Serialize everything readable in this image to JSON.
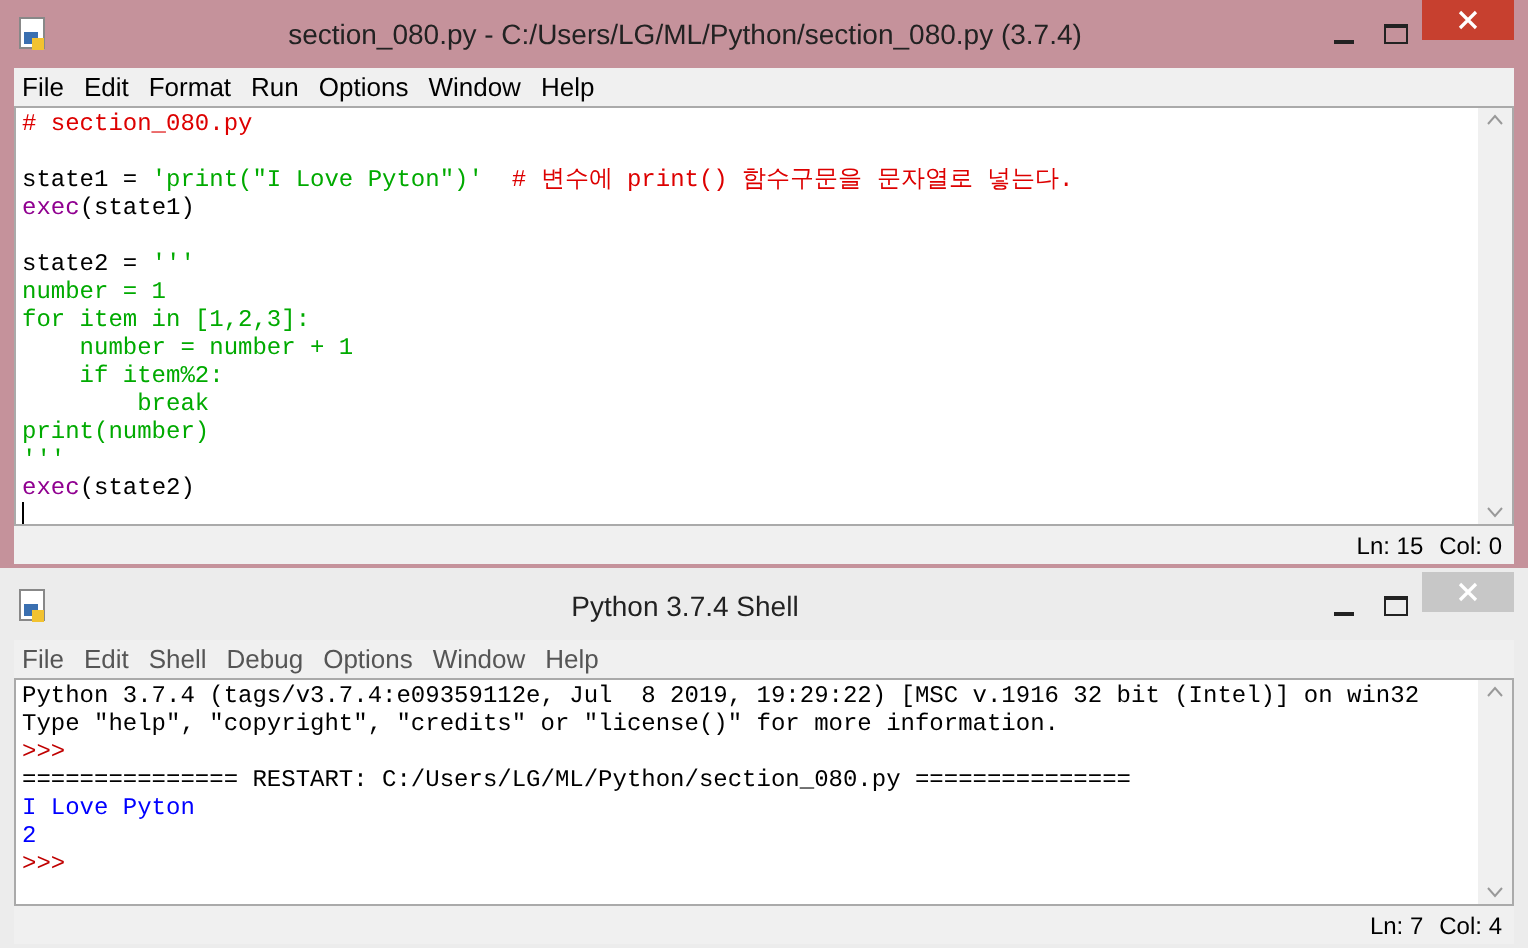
{
  "editor": {
    "title": "section_080.py - C:/Users/LG/ML/Python/section_080.py (3.7.4)",
    "active": true,
    "menu": [
      "File",
      "Edit",
      "Format",
      "Run",
      "Options",
      "Window",
      "Help"
    ],
    "lines": [
      {
        "kind": "code",
        "tokens": [
          {
            "kind": "comment",
            "text": "# section_080.py"
          }
        ]
      },
      {
        "kind": "blank"
      },
      {
        "kind": "code",
        "tokens": [
          {
            "kind": "plain",
            "text": "state1 = "
          },
          {
            "kind": "string",
            "text": "'print(\"I Love Pyton\")'"
          },
          {
            "kind": "comment",
            "text": "  # 변수에 print() 함수구문을 문자열로 넣는다."
          }
        ]
      },
      {
        "kind": "code",
        "tokens": [
          {
            "kind": "builtin",
            "text": "exec"
          },
          {
            "kind": "plain",
            "text": "(state1)"
          }
        ]
      },
      {
        "kind": "blank"
      },
      {
        "kind": "code",
        "tokens": [
          {
            "kind": "plain",
            "text": "state2 = "
          },
          {
            "kind": "string",
            "text": "'''"
          }
        ]
      },
      {
        "kind": "code",
        "tokens": [
          {
            "kind": "string",
            "text": "number = 1"
          }
        ]
      },
      {
        "kind": "code",
        "tokens": [
          {
            "kind": "string",
            "text": "for item in [1,2,3]:"
          }
        ]
      },
      {
        "kind": "code",
        "tokens": [
          {
            "kind": "string",
            "text": "    number = number + 1"
          }
        ]
      },
      {
        "kind": "code",
        "tokens": [
          {
            "kind": "string",
            "text": "    if item%2:"
          }
        ]
      },
      {
        "kind": "code",
        "tokens": [
          {
            "kind": "string",
            "text": "        break"
          }
        ]
      },
      {
        "kind": "code",
        "tokens": [
          {
            "kind": "string",
            "text": "print(number)"
          }
        ]
      },
      {
        "kind": "code",
        "tokens": [
          {
            "kind": "string",
            "text": "'''"
          }
        ]
      },
      {
        "kind": "code",
        "tokens": [
          {
            "kind": "builtin",
            "text": "exec"
          },
          {
            "kind": "plain",
            "text": "(state2)"
          }
        ]
      },
      {
        "kind": "cursor"
      }
    ],
    "status": [
      "Ln: 15",
      "Col: 0"
    ]
  },
  "shell": {
    "title": "Python 3.7.4 Shell",
    "active": false,
    "menu": [
      "File",
      "Edit",
      "Shell",
      "Debug",
      "Options",
      "Window",
      "Help"
    ],
    "lines": [
      {
        "kind": "code",
        "tokens": [
          {
            "kind": "plain",
            "text": "Python 3.7.4 (tags/v3.7.4:e09359112e, Jul  8 2019, 19:29:22) [MSC v.1916 32 bit (Intel)] on win32"
          }
        ]
      },
      {
        "kind": "code",
        "tokens": [
          {
            "kind": "plain",
            "text": "Type \"help\", \"copyright\", \"credits\" or \"license()\" for more information."
          }
        ]
      },
      {
        "kind": "code",
        "tokens": [
          {
            "kind": "prompt",
            "text": ">>>"
          }
        ]
      },
      {
        "kind": "code",
        "tokens": [
          {
            "kind": "plain",
            "text": "=============== RESTART: C:/Users/LG/ML/Python/section_080.py ==============="
          }
        ]
      },
      {
        "kind": "code",
        "tokens": [
          {
            "kind": "output",
            "text": "I Love Pyton"
          }
        ]
      },
      {
        "kind": "code",
        "tokens": [
          {
            "kind": "output",
            "text": "2"
          }
        ]
      },
      {
        "kind": "code",
        "tokens": [
          {
            "kind": "prompt",
            "text": ">>>"
          }
        ]
      }
    ],
    "status": [
      "Ln: 7",
      "Col: 4"
    ]
  }
}
